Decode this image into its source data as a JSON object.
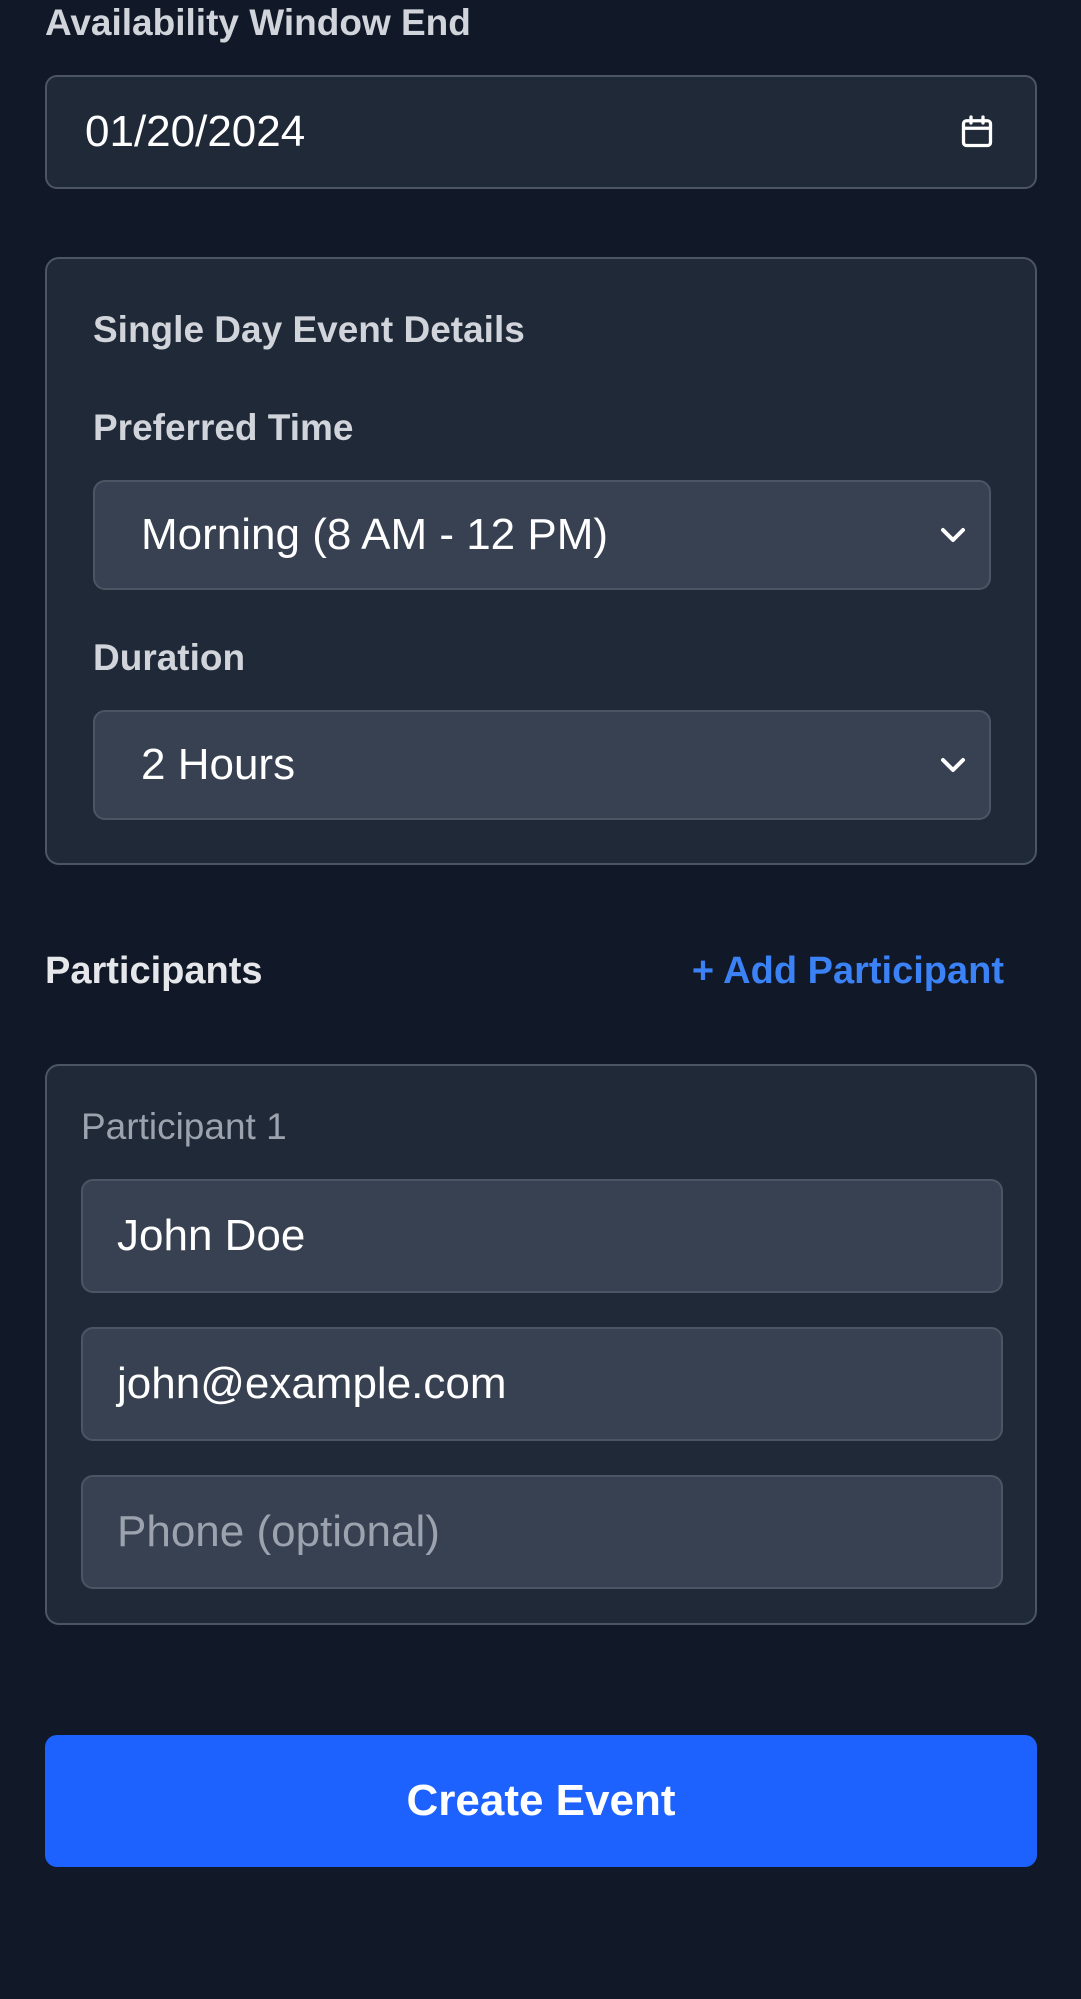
{
  "availability_end": {
    "label": "Availability Window End",
    "value": "01/20/2024",
    "icon": "calendar-icon"
  },
  "single_day_details": {
    "title": "Single Day Event Details",
    "preferred_time": {
      "label": "Preferred Time",
      "value": "Morning (8 AM - 12 PM)"
    },
    "duration": {
      "label": "Duration",
      "value": "2 Hours"
    }
  },
  "participants": {
    "title": "Participants",
    "add_label": "+ Add Participant",
    "items": [
      {
        "label": "Participant 1",
        "name": "John Doe",
        "email": "john@example.com",
        "phone_placeholder": "Phone (optional)"
      }
    ]
  },
  "actions": {
    "create_label": "Create Event"
  },
  "colors": {
    "background": "#111827",
    "card": "#1f2937",
    "accent_link": "#3b82f6",
    "primary_button": "#1d62fe"
  }
}
